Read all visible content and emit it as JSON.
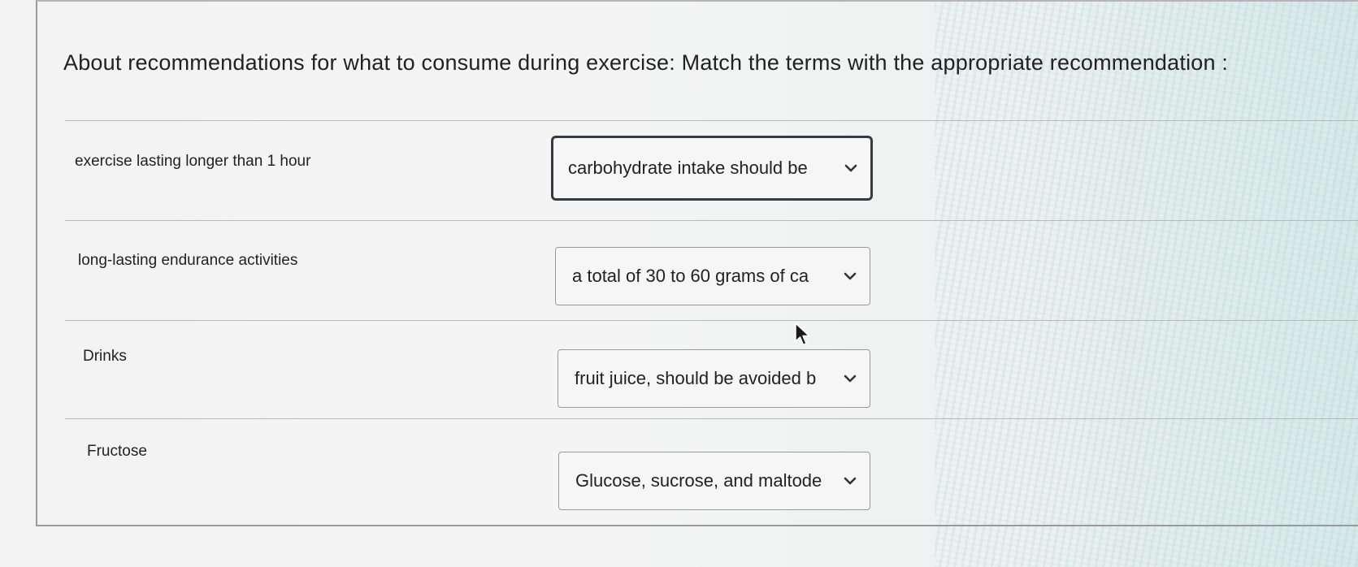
{
  "question": {
    "text": "About recommendations for what to consume during exercise: Match the terms with the appropriate recommendation :"
  },
  "rows": [
    {
      "term": "exercise lasting longer than 1 hour",
      "selected": "carbohydrate intake should be"
    },
    {
      "term": "long-lasting endurance activities",
      "selected": "a total of 30 to 60 grams of ca"
    },
    {
      "term": "Drinks",
      "selected": "fruit juice, should be avoided b"
    },
    {
      "term": "Fructose",
      "selected": "Glucose, sucrose, and maltode"
    }
  ],
  "icons": {
    "dropdown": "chevron-down-icon",
    "cursor": "mouse-pointer-icon"
  },
  "colors": {
    "focus_border": "#333b44",
    "text": "#222222"
  }
}
